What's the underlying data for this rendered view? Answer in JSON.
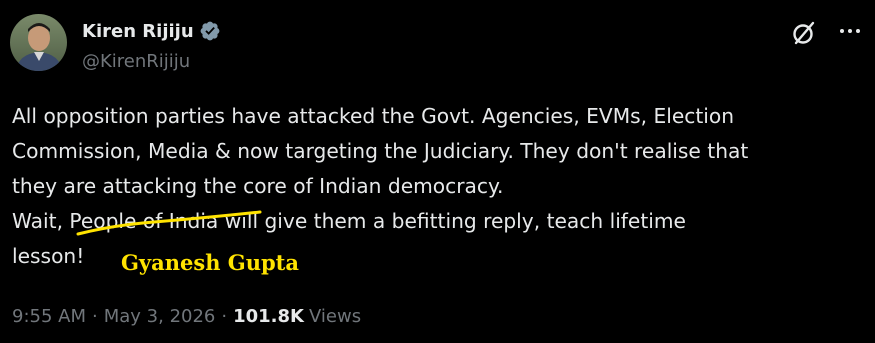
{
  "author": {
    "display_name": "Kiren Rijiju",
    "handle": "@KirenRijiju",
    "verified": true
  },
  "tweet": {
    "lines": [
      "All opposition parties have attacked the Govt. Agencies,  EVMs, Election",
      "Commission, Media & now targeting the Judiciary. They don't realise that",
      "they are attacking the core of Indian democracy.",
      "Wait, People of India will give them a befitting reply, teach lifetime",
      "lesson!"
    ]
  },
  "annotation": {
    "signature_text": "Gyanesh Gupta",
    "color": "#ffe300"
  },
  "meta": {
    "time": "9:55 AM",
    "separator": "·",
    "date": "May 3, 2026",
    "views_count": "101.8K",
    "views_label": "Views"
  },
  "icons": {
    "verified": "verified-badge-icon",
    "grok": "grok-icon",
    "more": "more-options-icon"
  },
  "colors": {
    "background": "#000000",
    "text_primary": "#e7e9ea",
    "text_secondary": "#71767b",
    "verified_badge": "#829aab"
  }
}
